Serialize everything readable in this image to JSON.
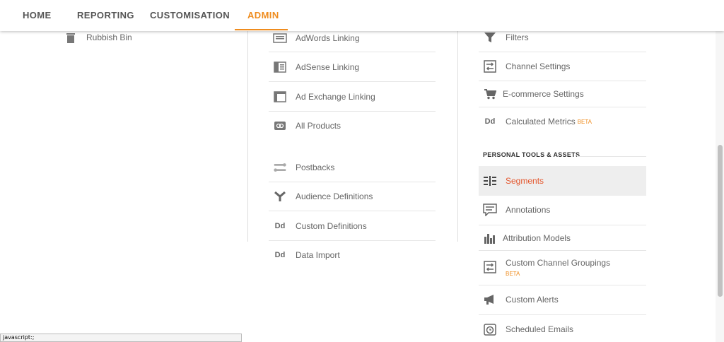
{
  "nav": {
    "tabs": [
      {
        "label": "HOME"
      },
      {
        "label": "REPORTING"
      },
      {
        "label": "CUSTOMISATION"
      },
      {
        "label": "ADMIN"
      }
    ],
    "active_color": "#ef8c1e"
  },
  "account_column": {
    "items": [
      {
        "label": "Rubbish Bin",
        "icon": "trash-icon"
      }
    ]
  },
  "property_column": {
    "items": [
      {
        "label": "AdWords Linking",
        "icon": "adwords-icon"
      },
      {
        "label": "AdSense Linking",
        "icon": "adsense-icon"
      },
      {
        "label": "Ad Exchange Linking",
        "icon": "ad-exchange-icon"
      },
      {
        "label": "All Products",
        "icon": "link-icon"
      },
      {
        "label": "Postbacks",
        "icon": "postbacks-icon"
      },
      {
        "label": "Audience Definitions",
        "icon": "audience-icon"
      },
      {
        "label": "Custom Definitions",
        "icon": "dd-icon",
        "glyph": "Dd"
      },
      {
        "label": "Data Import",
        "icon": "dd-icon",
        "glyph": "Dd"
      }
    ]
  },
  "view_column": {
    "items": [
      {
        "label": "Filters",
        "icon": "filter-icon"
      },
      {
        "label": "Channel Settings",
        "icon": "channel-icon"
      },
      {
        "label": "E-commerce Settings",
        "icon": "cart-icon"
      },
      {
        "label": "Calculated Metrics",
        "badge": "BETA",
        "icon": "dd-icon",
        "glyph": "Dd"
      }
    ],
    "section_title": "PERSONAL TOOLS & ASSETS",
    "personal_items": [
      {
        "label": "Segments",
        "icon": "segments-icon",
        "selected": true
      },
      {
        "label": "Annotations",
        "icon": "annotation-icon"
      },
      {
        "label": "Attribution Models",
        "icon": "bar-chart-icon"
      },
      {
        "label": "Custom Channel Groupings",
        "badge": "BETA",
        "icon": "channel-icon"
      },
      {
        "label": "Custom Alerts",
        "icon": "megaphone-icon"
      },
      {
        "label": "Scheduled Emails",
        "icon": "clock-icon"
      }
    ],
    "selected_color": "#e4572e"
  },
  "status_bar": {
    "text": "javascript:;"
  }
}
